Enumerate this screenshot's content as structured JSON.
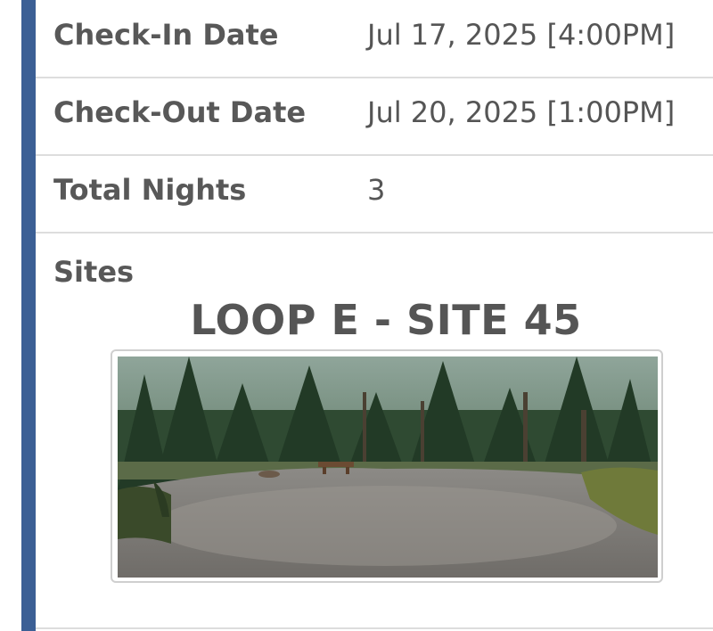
{
  "reservation": {
    "check_in_label": "Check-In Date",
    "check_in_value": "Jul 17, 2025 [4:00PM]",
    "check_out_label": "Check-Out Date",
    "check_out_value": "Jul 20, 2025 [1:00PM]",
    "nights_label": "Total Nights",
    "nights_value": "3",
    "sites_label": "Sites"
  },
  "site": {
    "title": "LOOP E - SITE 45",
    "photo_icon": "campsite-photo"
  },
  "colors": {
    "accent_bar": "#3b5f95",
    "divider": "#dddddd",
    "text": "#555555"
  }
}
